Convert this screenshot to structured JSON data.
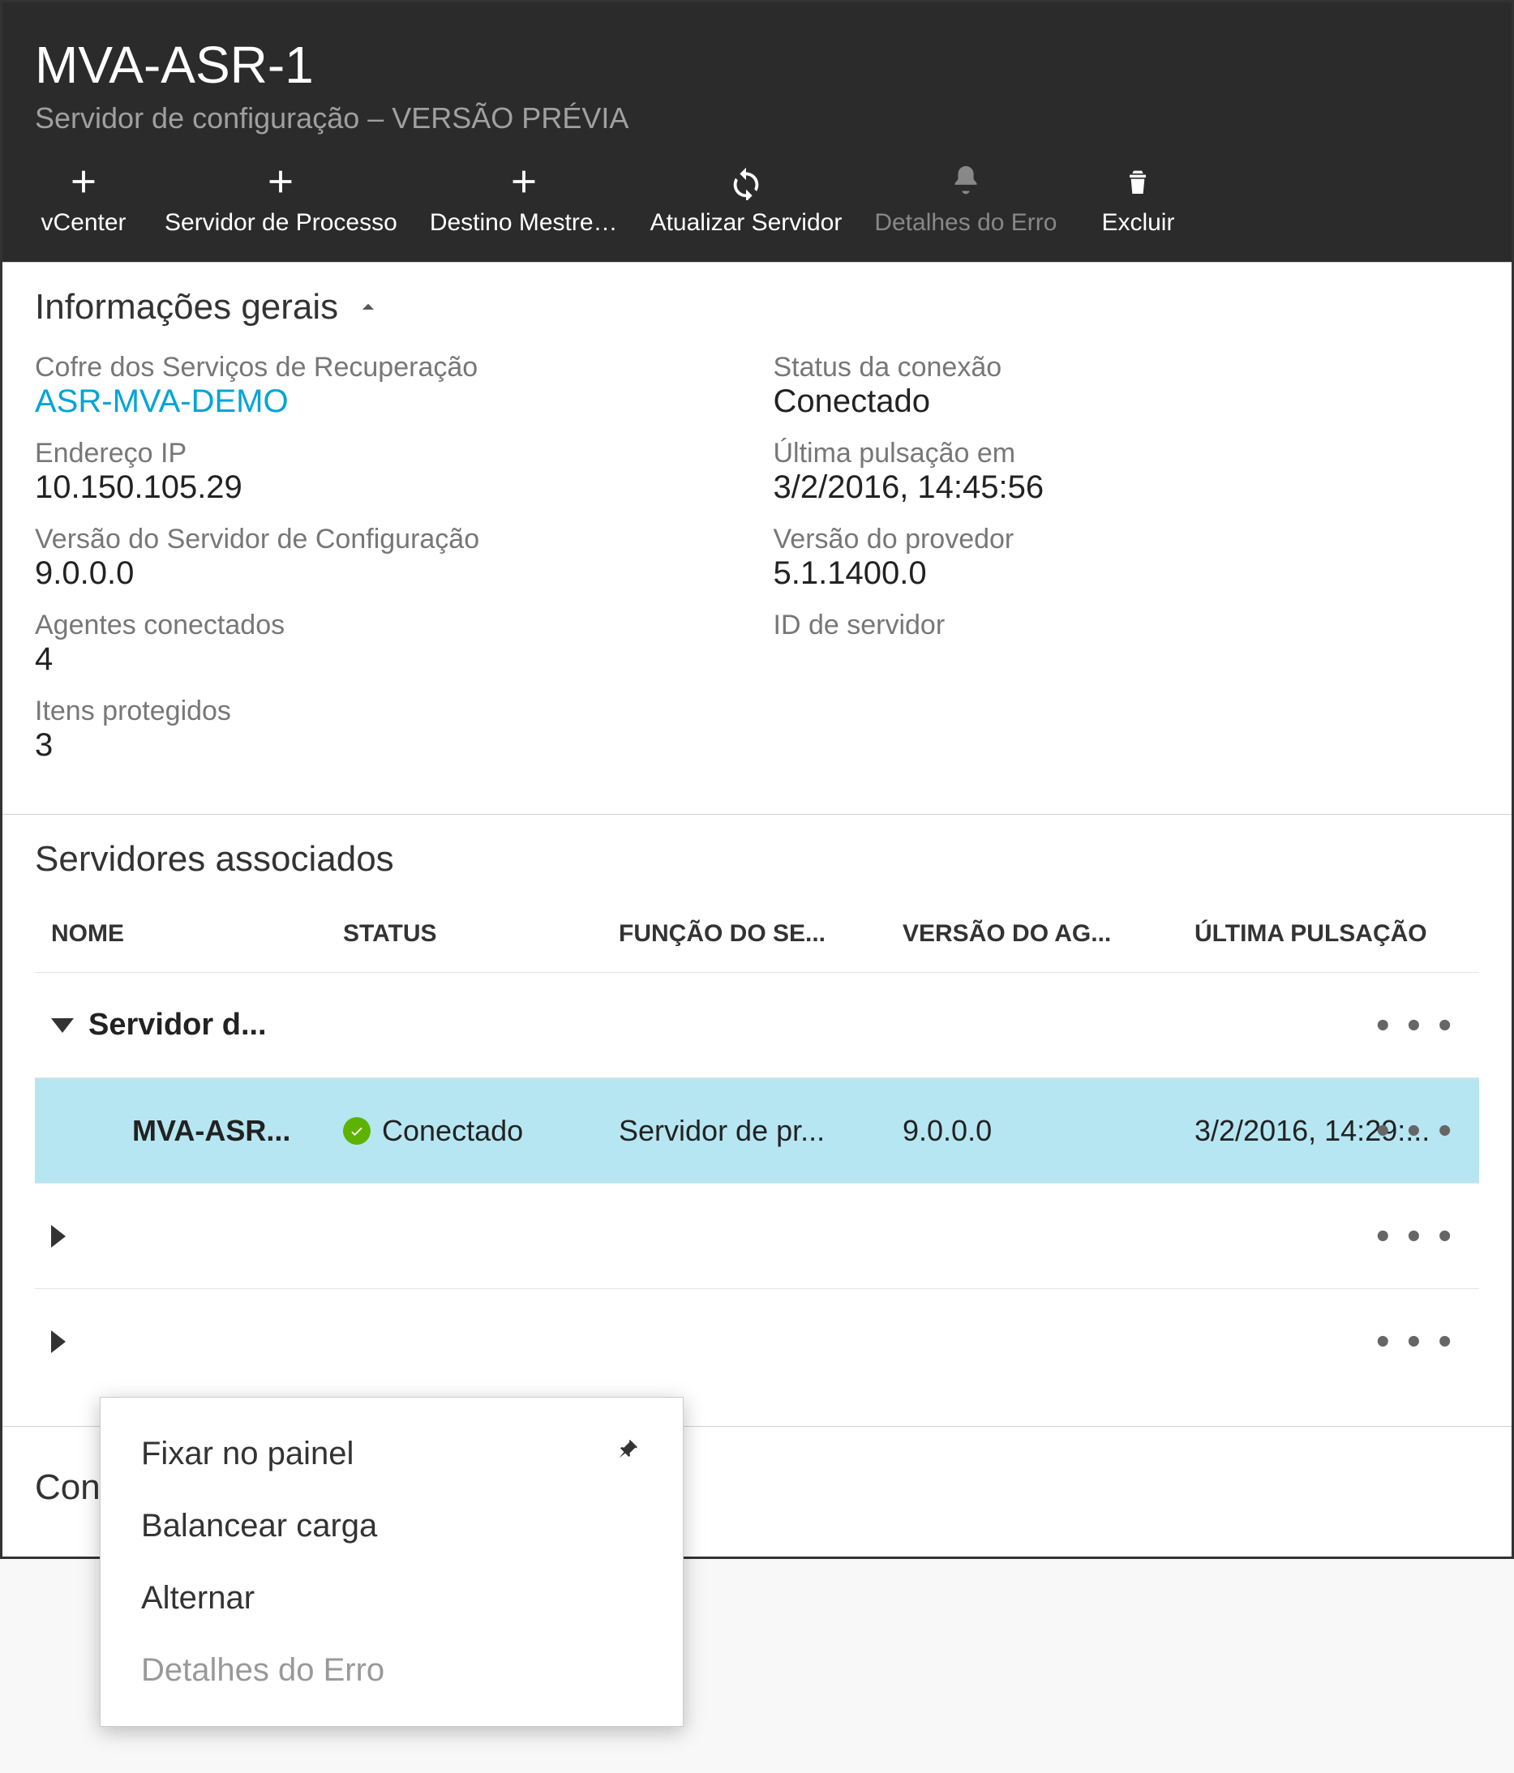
{
  "header": {
    "title": "MVA-ASR-1",
    "subtitle": "Servidor de configuração – VERSÃO PRÉVIA"
  },
  "toolbar": {
    "vcenter": "vCenter",
    "process_server": "Servidor de Processo",
    "master_target": "Destino Mestre…",
    "refresh": "Atualizar Servidor",
    "error_details": "Detalhes do Erro",
    "delete": "Excluir"
  },
  "general": {
    "heading": "Informações gerais",
    "vault_label": "Cofre dos Serviços de Recuperação",
    "vault_value": "ASR-MVA-DEMO",
    "conn_status_label": "Status da conexão",
    "conn_status_value": "Conectado",
    "ip_label": "Endereço IP",
    "ip_value": "10.150.105.29",
    "last_heartbeat_label": "Última pulsação em",
    "last_heartbeat_value": "3/2/2016, 14:45:56",
    "cs_version_label": "Versão do Servidor de Configuração",
    "cs_version_value": "9.0.0.0",
    "provider_version_label": "Versão do provedor",
    "provider_version_value": "5.1.1400.0",
    "agents_label": "Agentes conectados",
    "agents_value": "4",
    "server_id_label": "ID de servidor",
    "server_id_value": "",
    "protected_label": "Itens protegidos",
    "protected_value": "3"
  },
  "servers": {
    "heading": "Servidores associados",
    "columns": {
      "name": "NOME",
      "status": "STATUS",
      "role": "FUNÇÃO DO SE...",
      "version": "VERSÃO DO AG...",
      "last": "ÚLTIMA PULSAÇÃO"
    },
    "group1": "Servidor d...",
    "row": {
      "name": "MVA-ASR...",
      "status": "Conectado",
      "role": "Servidor de pr...",
      "version": "9.0.0.0",
      "last": "3/2/2016, 14:29:..."
    }
  },
  "context": {
    "pin": "Fixar no painel",
    "balance": "Balancear carga",
    "switch": "Alternar",
    "error": "Detalhes do Erro"
  },
  "connected_section": "Con"
}
